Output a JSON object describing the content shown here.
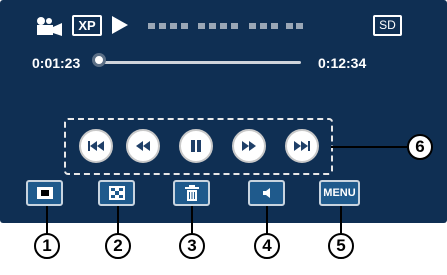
{
  "status_bar": {
    "quality": "XP",
    "media": "SD",
    "mode_icon": "video-camera-icon",
    "state_icon": "play-triangle-icon"
  },
  "playback": {
    "elapsed": "0:01:23",
    "total": "0:12:34",
    "progress": 0.0
  },
  "transport": {
    "buttons": [
      "skip-back-icon",
      "rewind-icon",
      "pause-icon",
      "fast-forward-icon",
      "skip-forward-icon"
    ]
  },
  "bottom_bar": {
    "menu_label": "MENU",
    "icons": [
      "snapshot-icon",
      "index-grid-icon",
      "trash-icon",
      "volume-icon"
    ]
  },
  "callouts": [
    "1",
    "2",
    "3",
    "4",
    "5",
    "6"
  ],
  "colors": {
    "screen_bg": "#0f2f53",
    "button_bg": "#1f5a8c"
  }
}
